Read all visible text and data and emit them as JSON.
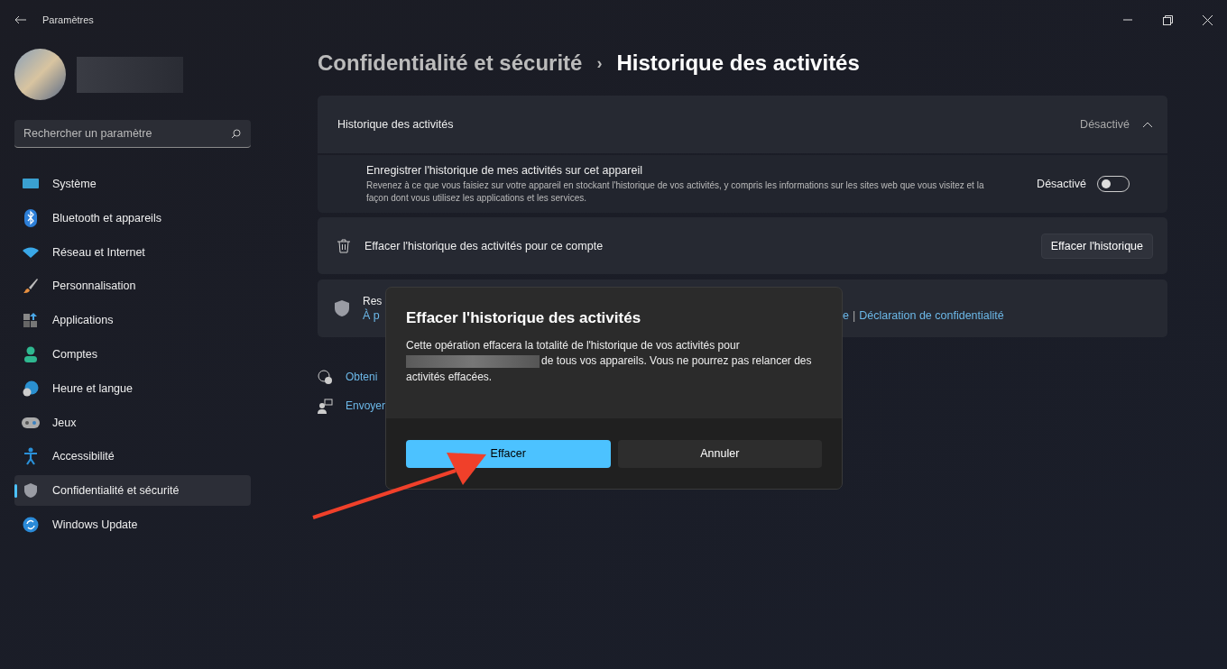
{
  "window": {
    "title": "Paramètres"
  },
  "search": {
    "placeholder": "Rechercher un paramètre"
  },
  "sidebar": {
    "items": [
      {
        "label": "Système",
        "selected": false
      },
      {
        "label": "Bluetooth et appareils",
        "selected": false
      },
      {
        "label": "Réseau et Internet",
        "selected": false
      },
      {
        "label": "Personnalisation",
        "selected": false
      },
      {
        "label": "Applications",
        "selected": false
      },
      {
        "label": "Comptes",
        "selected": false
      },
      {
        "label": "Heure et langue",
        "selected": false
      },
      {
        "label": "Jeux",
        "selected": false
      },
      {
        "label": "Accessibilité",
        "selected": false
      },
      {
        "label": "Confidentialité et sécurité",
        "selected": true
      },
      {
        "label": "Windows Update",
        "selected": false
      }
    ]
  },
  "breadcrumb": {
    "parent": "Confidentialité et sécurité",
    "separator": "›",
    "current": "Historique des activités"
  },
  "history_section": {
    "title": "Historique des activités",
    "status": "Désactivé",
    "expanded": true,
    "setting": {
      "title": "Enregistrer l'historique de mes activités sur cet appareil",
      "description": "Revenez à ce que vous faisiez sur votre appareil en stockant l'historique de vos activités, y compris les informations sur les sites web que vous visitez et la façon dont vous utilisez les applications et les services.",
      "toggle_label": "Désactivé",
      "on": false
    }
  },
  "clear_row": {
    "label": "Effacer l'historique des activités pour ce compte",
    "button": "Effacer l'historique"
  },
  "privacy_row": {
    "title": "Res",
    "link_start": "À p",
    "link_end": "e",
    "separator": "|",
    "link": "Déclaration de confidentialité"
  },
  "help_links": [
    "Obteni",
    "Envoyer"
  ],
  "dialog": {
    "title": "Effacer l'historique des activités",
    "body_start": "Cette opération effacera la totalité de l'historique de vos activités pour",
    "body_end": "de tous vos appareils. Vous ne pourrez pas relancer des activités effacées.",
    "buttons": [
      {
        "label": "Effacer",
        "primary": true
      },
      {
        "label": "Annuler",
        "primary": false
      }
    ]
  }
}
